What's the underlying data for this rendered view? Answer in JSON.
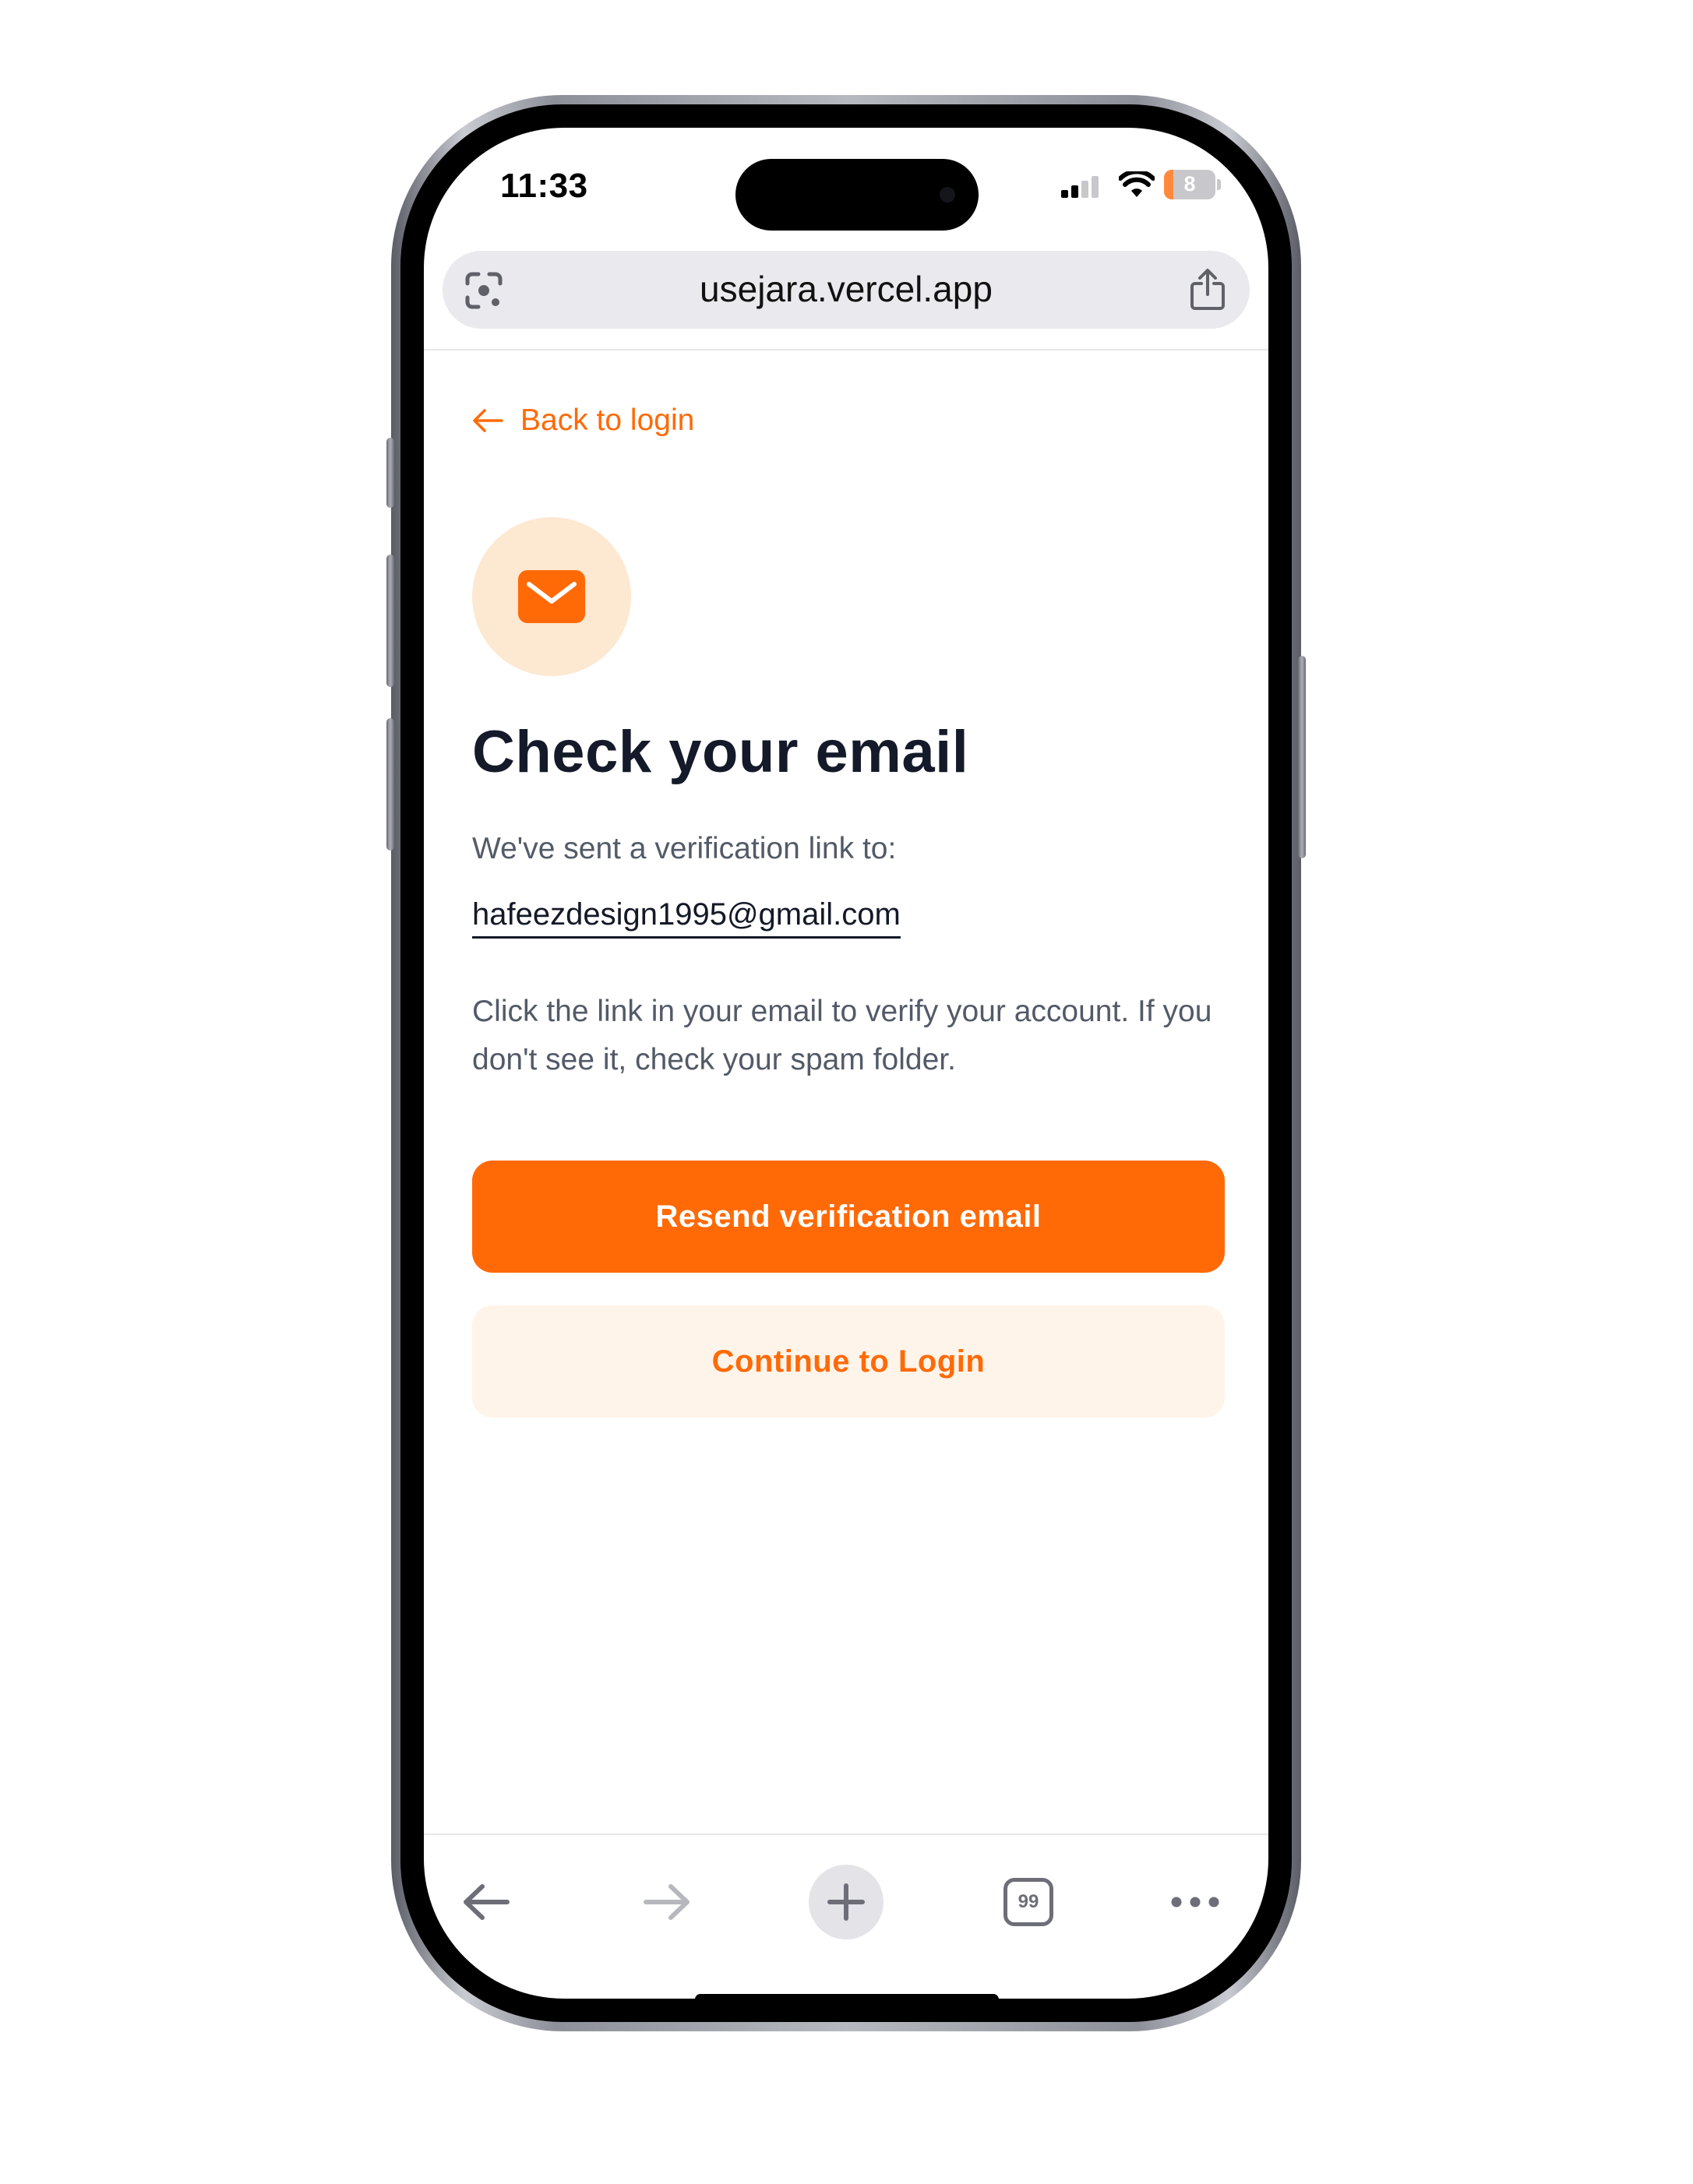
{
  "status_bar": {
    "time": "11:33",
    "battery_level": "8"
  },
  "browser": {
    "url": "usejara.vercel.app",
    "tab_count": "99"
  },
  "page": {
    "back_link": "Back to login",
    "title": "Check your email",
    "sent_text": "We've sent a verification link to:",
    "email": "hafeezdesign1995@gmail.com",
    "instructions": "Click the link in your email to verify your account. If you don't see it, check your spam folder.",
    "resend_button": "Resend verification email",
    "continue_button": "Continue to Login"
  },
  "icons": {
    "back_link": "arrow-left-icon",
    "mail": "mail-icon",
    "lens": "google-lens-icon",
    "share": "share-icon",
    "toolbar": [
      "back-arrow-icon",
      "forward-arrow-icon",
      "plus-icon",
      "tabs-icon",
      "more-icon"
    ]
  },
  "colors": {
    "accent": "#ff6a07",
    "accent_soft": "#fde8d2",
    "secondary_button_bg": "#fff4ea",
    "title": "#151a2a",
    "body_text": "#535a68"
  }
}
